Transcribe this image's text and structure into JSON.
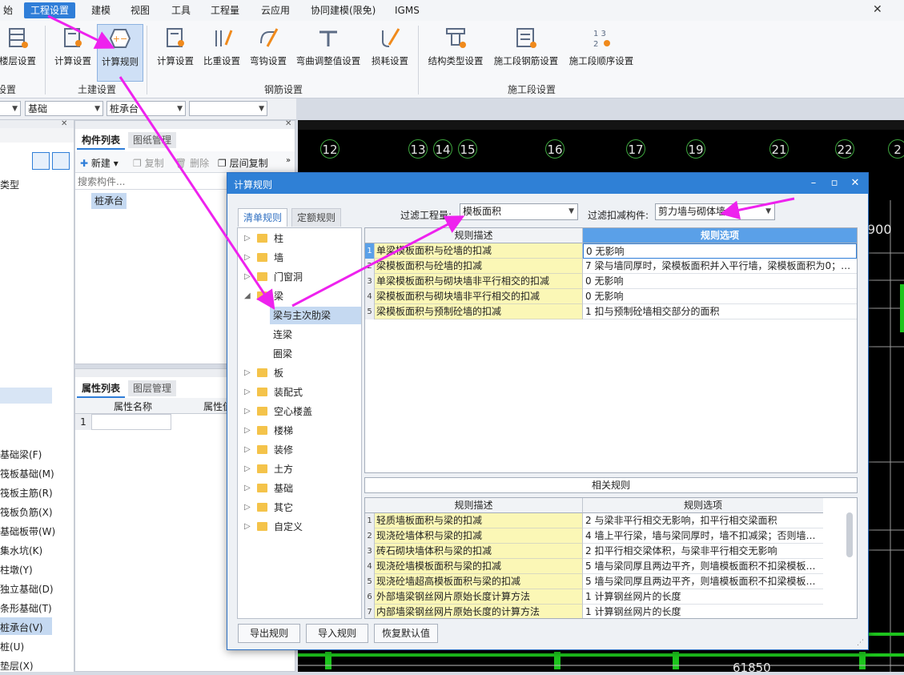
{
  "menu": [
    "始",
    "工程设置",
    "建模",
    "视图",
    "工具",
    "工程量",
    "云应用",
    "协同建模(限免)",
    "IGMS"
  ],
  "menu_active": "工程设置",
  "ribbon": {
    "buttons_left": [
      "楼层设置",
      "计算设置",
      "计算规则"
    ],
    "buttons_rebar": [
      "计算设置",
      "比重设置",
      "弯钩设置",
      "弯曲调整值设置",
      "损耗设置"
    ],
    "buttons_stage": [
      "结构类型设置",
      "施工段钢筋设置",
      "施工段顺序设置"
    ],
    "groups": [
      "设置",
      "土建设置",
      "钢筋设置",
      "施工段设置"
    ]
  },
  "combos": [
    "基础",
    "桩承台",
    ""
  ],
  "left_items": [
    "类型",
    "基础梁(F)",
    "筏板基础(M)",
    "筏板主筋(R)",
    "筏板负筋(X)",
    "基础板带(W)",
    "集水坑(K)",
    "柱墩(Y)",
    "独立基础(D)",
    "条形基础(T)",
    "桩承台(V)",
    "桩(U)",
    "垫层(X)"
  ],
  "comp_panel": {
    "tabs": [
      "构件列表",
      "图纸管理"
    ],
    "tools": [
      "新建",
      "复制",
      "删除",
      "层间复制"
    ],
    "search_placeholder": "搜索构件...",
    "item": "桩承台"
  },
  "prop_panel": {
    "tabs": [
      "属性列表",
      "图层管理"
    ],
    "headers": [
      "属性名称",
      "属性值"
    ],
    "row_num": "1"
  },
  "canvas": {
    "axes": [
      "12",
      "13",
      "14",
      "15",
      "16",
      "17",
      "19",
      "21",
      "22",
      "2"
    ],
    "dim_top": "900",
    "dim_bottom": "61850"
  },
  "dialog": {
    "title": "计算规则",
    "tabs": [
      "清单规则",
      "定额规则"
    ],
    "filter_qty_label": "过滤工程量:",
    "filter_qty_value": "模板面积",
    "filter_member_label": "过滤扣减构件:",
    "filter_member_value": "剪力墙与砌体墙",
    "tree": [
      {
        "label": "柱",
        "exp": "▷"
      },
      {
        "label": "墙",
        "exp": "▷"
      },
      {
        "label": "门窗洞",
        "exp": "▷"
      },
      {
        "label": "梁",
        "exp": "◢"
      },
      {
        "label": "板",
        "exp": "▷"
      },
      {
        "label": "装配式",
        "exp": "▷"
      },
      {
        "label": "空心楼盖",
        "exp": "▷"
      },
      {
        "label": "楼梯",
        "exp": "▷"
      },
      {
        "label": "装修",
        "exp": "▷"
      },
      {
        "label": "土方",
        "exp": "▷"
      },
      {
        "label": "基础",
        "exp": "▷"
      },
      {
        "label": "其它",
        "exp": "▷"
      },
      {
        "label": "自定义",
        "exp": "▷"
      }
    ],
    "tree_sub": [
      "梁与主次肋梁",
      "连梁",
      "圈梁"
    ],
    "grid_headers": [
      "规则描述",
      "规则选项"
    ],
    "rules": [
      {
        "n": "1",
        "desc": "单梁模板面积与砼墙的扣减",
        "opt": "0   无影响"
      },
      {
        "n": "2",
        "desc": "梁模板面积与砼墙的扣减",
        "opt": "7 梁与墙同厚时，梁模板面积并入平行墙，梁模板面积为0；…"
      },
      {
        "n": "3",
        "desc": "单梁模板面积与砌块墙非平行相交的扣减",
        "opt": "0   无影响"
      },
      {
        "n": "4",
        "desc": "梁模板面积与砌块墙非平行相交的扣减",
        "opt": "0   无影响"
      },
      {
        "n": "5",
        "desc": "梁模板面积与预制砼墙的扣减",
        "opt": "1  扣与预制砼墙相交部分的面积"
      }
    ],
    "related_title": "相关规则",
    "related_headers": [
      "规则描述",
      "规则选项"
    ],
    "related": [
      {
        "n": "1",
        "desc": "轻质墙板面积与梁的扣减",
        "opt": "2 与梁非平行相交无影响，扣平行相交梁面积"
      },
      {
        "n": "2",
        "desc": "现浇砼墙体积与梁的扣减",
        "opt": "4   墙上平行梁，墙与梁同厚时，墙不扣减梁；否则墙…"
      },
      {
        "n": "3",
        "desc": "砖石砌块墙体积与梁的扣减",
        "opt": "2   扣平行相交梁体积，与梁非平行相交无影响"
      },
      {
        "n": "4",
        "desc": "现浇砼墙模板面积与梁的扣减",
        "opt": "5   墙与梁同厚且两边平齐，则墙模板面积不扣梁模板…"
      },
      {
        "n": "5",
        "desc": "现浇砼墙超高模板面积与梁的扣减",
        "opt": "5   墙与梁同厚且两边平齐，则墙模板面积不扣梁模板…"
      },
      {
        "n": "6",
        "desc": "外部墙梁钢丝网片原始长度计算方法",
        "opt": "1   计算钢丝网片的长度"
      },
      {
        "n": "7",
        "desc": "内部墙梁钢丝网片原始长度的计算方法",
        "opt": "1   计算钢丝网片的长度"
      }
    ],
    "buttons": [
      "导出规则",
      "导入规则",
      "恢复默认值"
    ]
  },
  "colors": {
    "accent": "#2f80d6",
    "annotation": "#ee22ee",
    "desc_bg": "#fbf7b6"
  }
}
